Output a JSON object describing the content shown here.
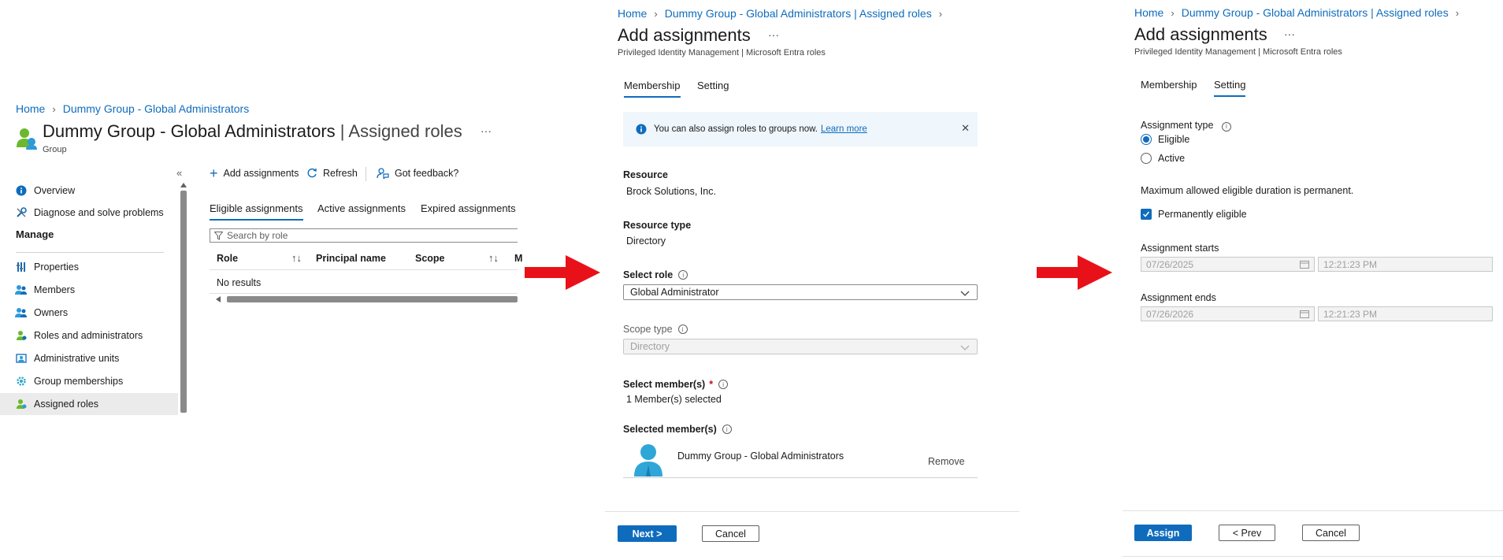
{
  "colors": {
    "accent": "#0f6cbd",
    "arrow": "#e8111a",
    "info_bg": "#eff6fc"
  },
  "panel1": {
    "breadcrumb": [
      "Home",
      "Dummy Group - Global Administrators"
    ],
    "title_main": "Dummy Group - Global Administrators",
    "title_suffix": "| Assigned roles",
    "subtitle": "Group",
    "more_label": "···",
    "collapse_label": "«",
    "sidebar": {
      "items_top": [
        {
          "label": "Overview",
          "icon": "info-icon"
        },
        {
          "label": "Diagnose and solve problems",
          "icon": "wrench-icon"
        }
      ],
      "section_label": "Manage",
      "items_manage": [
        {
          "label": "Properties",
          "icon": "properties-icon"
        },
        {
          "label": "Members",
          "icon": "members-icon"
        },
        {
          "label": "Owners",
          "icon": "owners-icon"
        },
        {
          "label": "Roles and administrators",
          "icon": "roles-icon"
        },
        {
          "label": "Administrative units",
          "icon": "admin-units-icon"
        },
        {
          "label": "Group memberships",
          "icon": "gear-icon"
        },
        {
          "label": "Assigned roles",
          "icon": "assigned-roles-icon"
        }
      ]
    },
    "toolbar": {
      "add": "Add assignments",
      "refresh": "Refresh",
      "feedback": "Got feedback?"
    },
    "tabs": [
      "Eligible assignments",
      "Active assignments",
      "Expired assignments"
    ],
    "search_placeholder": "Search by role",
    "columns": [
      "Role",
      "Principal name",
      "Scope",
      "M"
    ],
    "no_results": "No results"
  },
  "panel2": {
    "breadcrumb": [
      "Home",
      "Dummy Group - Global Administrators | Assigned roles"
    ],
    "title": "Add assignments",
    "more_label": "···",
    "subtitle": "Privileged Identity Management | Microsoft Entra roles",
    "tabs": [
      "Membership",
      "Setting"
    ],
    "info_text": "You can also assign roles to groups now.",
    "info_link": "Learn more",
    "resource_label": "Resource",
    "resource_value": "Brock Solutions, Inc.",
    "resource_type_label": "Resource type",
    "resource_type_value": "Directory",
    "select_role_label": "Select role",
    "select_role_value": "Global Administrator",
    "scope_type_label": "Scope type",
    "scope_type_value": "Directory",
    "select_members_label": "Select member(s)",
    "required_marker": "*",
    "members_selected": "1 Member(s) selected",
    "selected_members_label": "Selected member(s)",
    "member_name": "Dummy Group - Global Administrators",
    "remove_label": "Remove",
    "next_label": "Next >",
    "cancel_label": "Cancel"
  },
  "panel3": {
    "breadcrumb": [
      "Home",
      "Dummy Group - Global Administrators | Assigned roles"
    ],
    "title": "Add assignments",
    "more_label": "···",
    "subtitle": "Privileged Identity Management | Microsoft Entra roles",
    "tabs": [
      "Membership",
      "Setting"
    ],
    "assignment_type_label": "Assignment type",
    "option_eligible": "Eligible",
    "option_active": "Active",
    "max_duration_text": "Maximum allowed eligible duration is permanent.",
    "permanent_label": "Permanently eligible",
    "starts_label": "Assignment starts",
    "starts_date": "07/26/2025",
    "starts_time": "12:21:23 PM",
    "ends_label": "Assignment ends",
    "ends_date": "07/26/2026",
    "ends_time": "12:21:23 PM",
    "assign_label": "Assign",
    "prev_label": "< Prev",
    "cancel_label": "Cancel"
  }
}
